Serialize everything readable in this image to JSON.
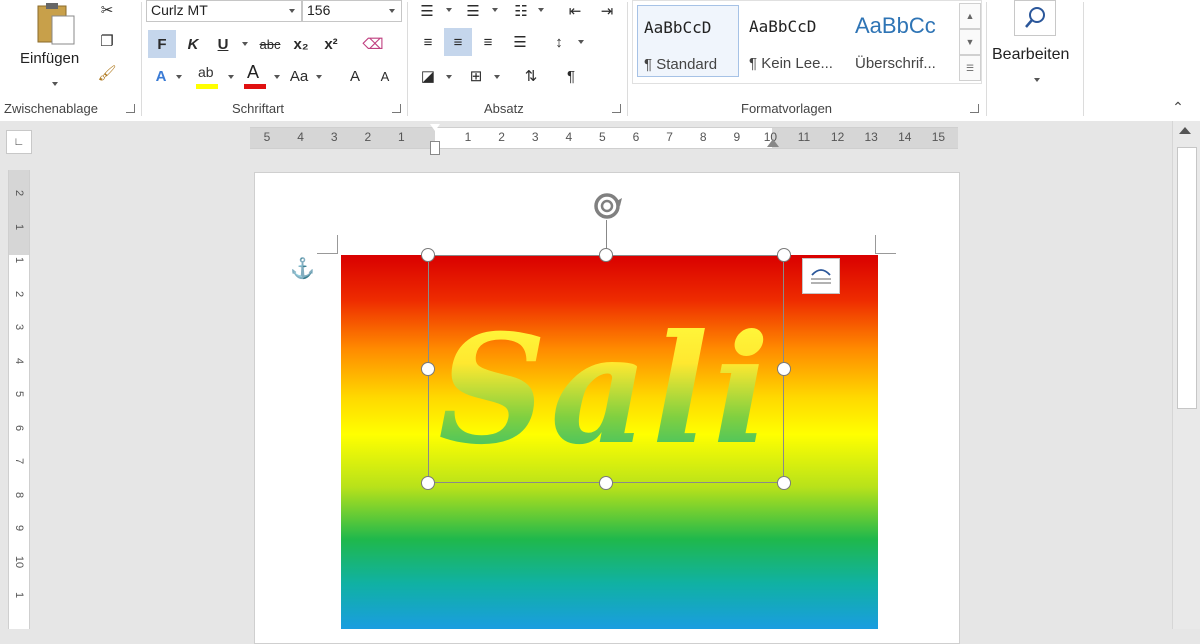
{
  "clipboard": {
    "paste_label": "Einfügen",
    "group_label": "Zwischenablage"
  },
  "font": {
    "name": "Curlz MT",
    "size": "156",
    "group_label": "Schriftart",
    "bold": "F",
    "italic": "K",
    "underline": "U",
    "strike": "abc",
    "subscript": "x₂",
    "superscript": "x²",
    "case": "Aa",
    "grow": "A",
    "shrink": "A"
  },
  "paragraph": {
    "group_label": "Absatz",
    "pilcrow": "¶"
  },
  "styles": {
    "group_label": "Formatvorlagen",
    "items": [
      {
        "sample": "AaBbCcD",
        "name": "¶ Standard"
      },
      {
        "sample": "AaBbCcD",
        "name": "¶ Kein Lee..."
      },
      {
        "sample": "AaBbCc",
        "name": "Überschrif..."
      }
    ]
  },
  "editing": {
    "label": "Bearbeiten"
  },
  "ruler": {
    "h_numbers": [
      "5",
      "4",
      "3",
      "2",
      "1",
      "1",
      "2",
      "3",
      "4",
      "5",
      "6",
      "7",
      "8",
      "9",
      "10",
      "11",
      "12",
      "13",
      "14",
      "15"
    ],
    "v_numbers": [
      "2",
      "1",
      "1",
      "2",
      "3",
      "4",
      "5",
      "6",
      "7",
      "8",
      "9",
      "10",
      "1"
    ]
  },
  "document": {
    "wordart_text": "Sali"
  },
  "colors": {
    "highlight": "#ffff00",
    "font_color": "#e01010",
    "accent": "#2b579a"
  }
}
